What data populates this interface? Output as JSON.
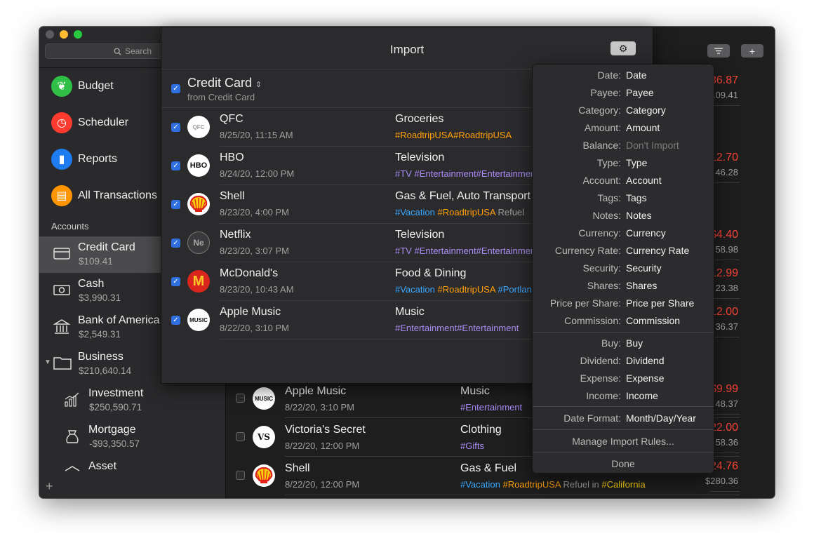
{
  "window": {
    "search_placeholder": "Search",
    "nav": [
      {
        "label": "Budget",
        "icon": "budget-leaf-icon",
        "color": "#30c048"
      },
      {
        "label": "Scheduler",
        "icon": "clock-icon",
        "color": "#ff3b30"
      },
      {
        "label": "Reports",
        "icon": "bar-chart-icon",
        "color": "#1e7cf0"
      },
      {
        "label": "All Transactions",
        "icon": "inbox-tray-icon",
        "color": "#ff9500"
      }
    ],
    "accounts_header": "Accounts",
    "accounts": [
      {
        "name": "Credit Card",
        "balance": "$109.41",
        "icon": "credit-card-icon",
        "selected": true
      },
      {
        "name": "Cash",
        "balance": "$3,990.31",
        "icon": "cash-icon"
      },
      {
        "name": "Bank of America",
        "balance": "$2,549.31",
        "icon": "bank-icon"
      },
      {
        "name": "Business",
        "balance": "$210,640.14",
        "icon": "folder-icon"
      },
      {
        "name": "Investment",
        "balance": "$250,590.71",
        "icon": "investment-chart-icon"
      },
      {
        "name": "Mortgage",
        "balance": "-$93,350.57",
        "icon": "mortgage-icon"
      },
      {
        "name": "Asset",
        "icon": "asset-icon"
      }
    ]
  },
  "background": {
    "right_amounts": [
      {
        "top": "36.87",
        "bottom": "109.41"
      },
      {
        "top": "12.70",
        "bottom": "46.28"
      },
      {
        "top": "$4.40",
        "bottom": "58.98"
      },
      {
        "top": "12.99",
        "bottom": "23.38"
      },
      {
        "top": "12.00",
        "bottom": "36.37"
      },
      {
        "top": "$9.99",
        "bottom": "48.37"
      },
      {
        "top": "22.00",
        "bottom": "58.36"
      },
      {
        "top": "24.76",
        "bottom": "$280.36"
      }
    ],
    "rows": [
      {
        "name": "Apple Music",
        "date": "8/22/20, 3:10 PM",
        "category": "Music",
        "logo": "MUSIC",
        "tags": [
          {
            "t": "#Entertainment",
            "c": "tp"
          }
        ]
      },
      {
        "name": "Victoria's Secret",
        "date": "8/22/20, 12:00 PM",
        "category": "Clothing",
        "logo": "VS",
        "tags": [
          {
            "t": "#Gifts",
            "c": "tp"
          }
        ]
      },
      {
        "name": "Shell",
        "date": "8/22/20, 12:00 PM",
        "category": "Gas & Fuel",
        "logo": "shell",
        "tags": [
          {
            "t": "#Vacation ",
            "c": "tb"
          },
          {
            "t": "#RoadtripUSA",
            "c": "to"
          },
          {
            "t": " Refuel in ",
            "c": "tgr"
          },
          {
            "t": "#California",
            "c": "ty"
          }
        ]
      }
    ]
  },
  "import": {
    "title": "Import",
    "account_name": "Credit Card",
    "account_sub": "from Credit Card",
    "rows": [
      {
        "name": "QFC",
        "date": "8/25/20, 11:15 AM",
        "category": "Groceries",
        "logo": "QFC",
        "tags": [
          {
            "t": "#RoadtripUSA#RoadtripUSA",
            "c": "to"
          }
        ]
      },
      {
        "name": "HBO",
        "date": "8/24/20, 12:00 PM",
        "category": "Television",
        "logo": "HBO",
        "tags": [
          {
            "t": "#TV #Entertainment#Entertainment",
            "c": "tp"
          }
        ]
      },
      {
        "name": "Shell",
        "date": "8/23/20, 4:00 PM",
        "category": "Gas & Fuel, Auto Transport",
        "logo": "shell",
        "tags": [
          {
            "t": "#Vacation ",
            "c": "tb"
          },
          {
            "t": "#RoadtripUSA",
            "c": "to"
          },
          {
            "t": " Refuel",
            "c": "tgr"
          }
        ]
      },
      {
        "name": "Netflix",
        "date": "8/23/20, 3:07 PM",
        "category": "Television",
        "logo": "Ne",
        "tags": [
          {
            "t": "#TV #Entertainment#Entertainment",
            "c": "tp"
          }
        ]
      },
      {
        "name": "McDonald's",
        "date": "8/23/20, 10:43 AM",
        "category": "Food & Dining",
        "logo": "M",
        "tags": [
          {
            "t": "#Vacation ",
            "c": "tb"
          },
          {
            "t": "#RoadtripUSA",
            "c": "to"
          },
          {
            "t": " #Portland",
            "c": "tb"
          }
        ]
      },
      {
        "name": "Apple Music",
        "date": "8/22/20, 3:10 PM",
        "category": "Music",
        "logo": "MUSIC",
        "tags": [
          {
            "t": "#Entertainment#Entertainment",
            "c": "tp"
          }
        ]
      }
    ]
  },
  "mapping": {
    "fields": [
      {
        "k": "Date:",
        "v": "Date"
      },
      {
        "k": "Payee:",
        "v": "Payee"
      },
      {
        "k": "Category:",
        "v": "Category"
      },
      {
        "k": "Amount:",
        "v": "Amount"
      },
      {
        "k": "Balance:",
        "v": "Don't Import",
        "dim": true
      },
      {
        "k": "Type:",
        "v": "Type"
      },
      {
        "k": "Account:",
        "v": "Account"
      },
      {
        "k": "Tags:",
        "v": "Tags"
      },
      {
        "k": "Notes:",
        "v": "Notes"
      },
      {
        "k": "Currency:",
        "v": "Currency"
      },
      {
        "k": "Currency Rate:",
        "v": "Currency Rate"
      },
      {
        "k": "Security:",
        "v": "Security"
      },
      {
        "k": "Shares:",
        "v": "Shares"
      },
      {
        "k": "Price per Share:",
        "v": "Price per Share"
      },
      {
        "k": "Commission:",
        "v": "Commission"
      }
    ],
    "types": [
      {
        "k": "Buy:",
        "v": "Buy"
      },
      {
        "k": "Dividend:",
        "v": "Dividend"
      },
      {
        "k": "Expense:",
        "v": "Expense"
      },
      {
        "k": "Income:",
        "v": "Income"
      }
    ],
    "date_format": {
      "k": "Date Format:",
      "v": "Month/Day/Year"
    },
    "manage_label": "Manage Import Rules...",
    "done_label": "Done"
  }
}
